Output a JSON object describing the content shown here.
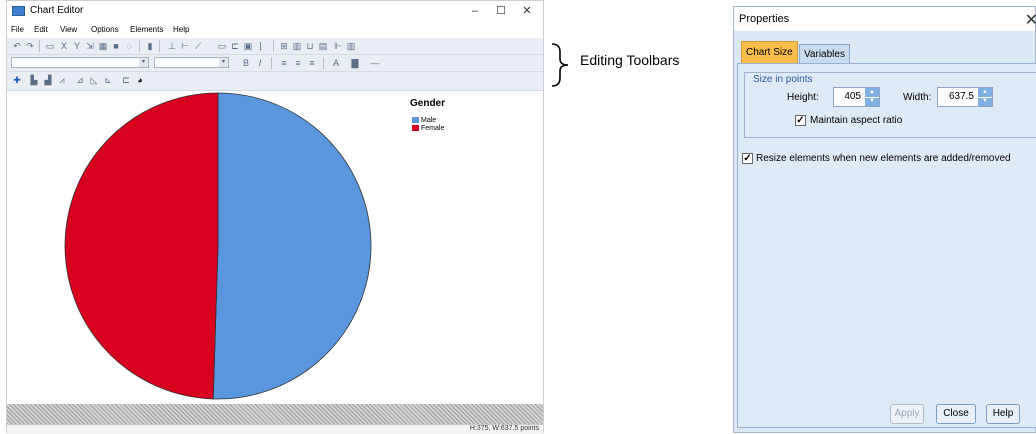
{
  "editor": {
    "title": "Chart Editor",
    "menu": [
      "File",
      "Edit",
      "View",
      "Options",
      "Elements",
      "Help"
    ],
    "status": "H:375, W:637.5 points"
  },
  "annotation": {
    "label": "Editing Toolbars"
  },
  "chart_data": {
    "type": "pie",
    "legend_title": "Gender",
    "categories": [
      "Male",
      "Female"
    ],
    "values": [
      50.5,
      49.5
    ],
    "colors": [
      "#5a96dd",
      "#d8001f"
    ],
    "legend_position": "top-right"
  },
  "properties": {
    "title": "Properties",
    "tabs": [
      "Chart Size",
      "Variables"
    ],
    "group_label": "Size in points",
    "height_label": "Height:",
    "height_value": "405",
    "width_label": "Width:",
    "width_value": "637.5",
    "maintain_aspect": "Maintain aspect ratio",
    "resize_elements": "Resize elements when new elements are added/removed",
    "apply": "Apply",
    "close": "Close",
    "help": "Help"
  }
}
